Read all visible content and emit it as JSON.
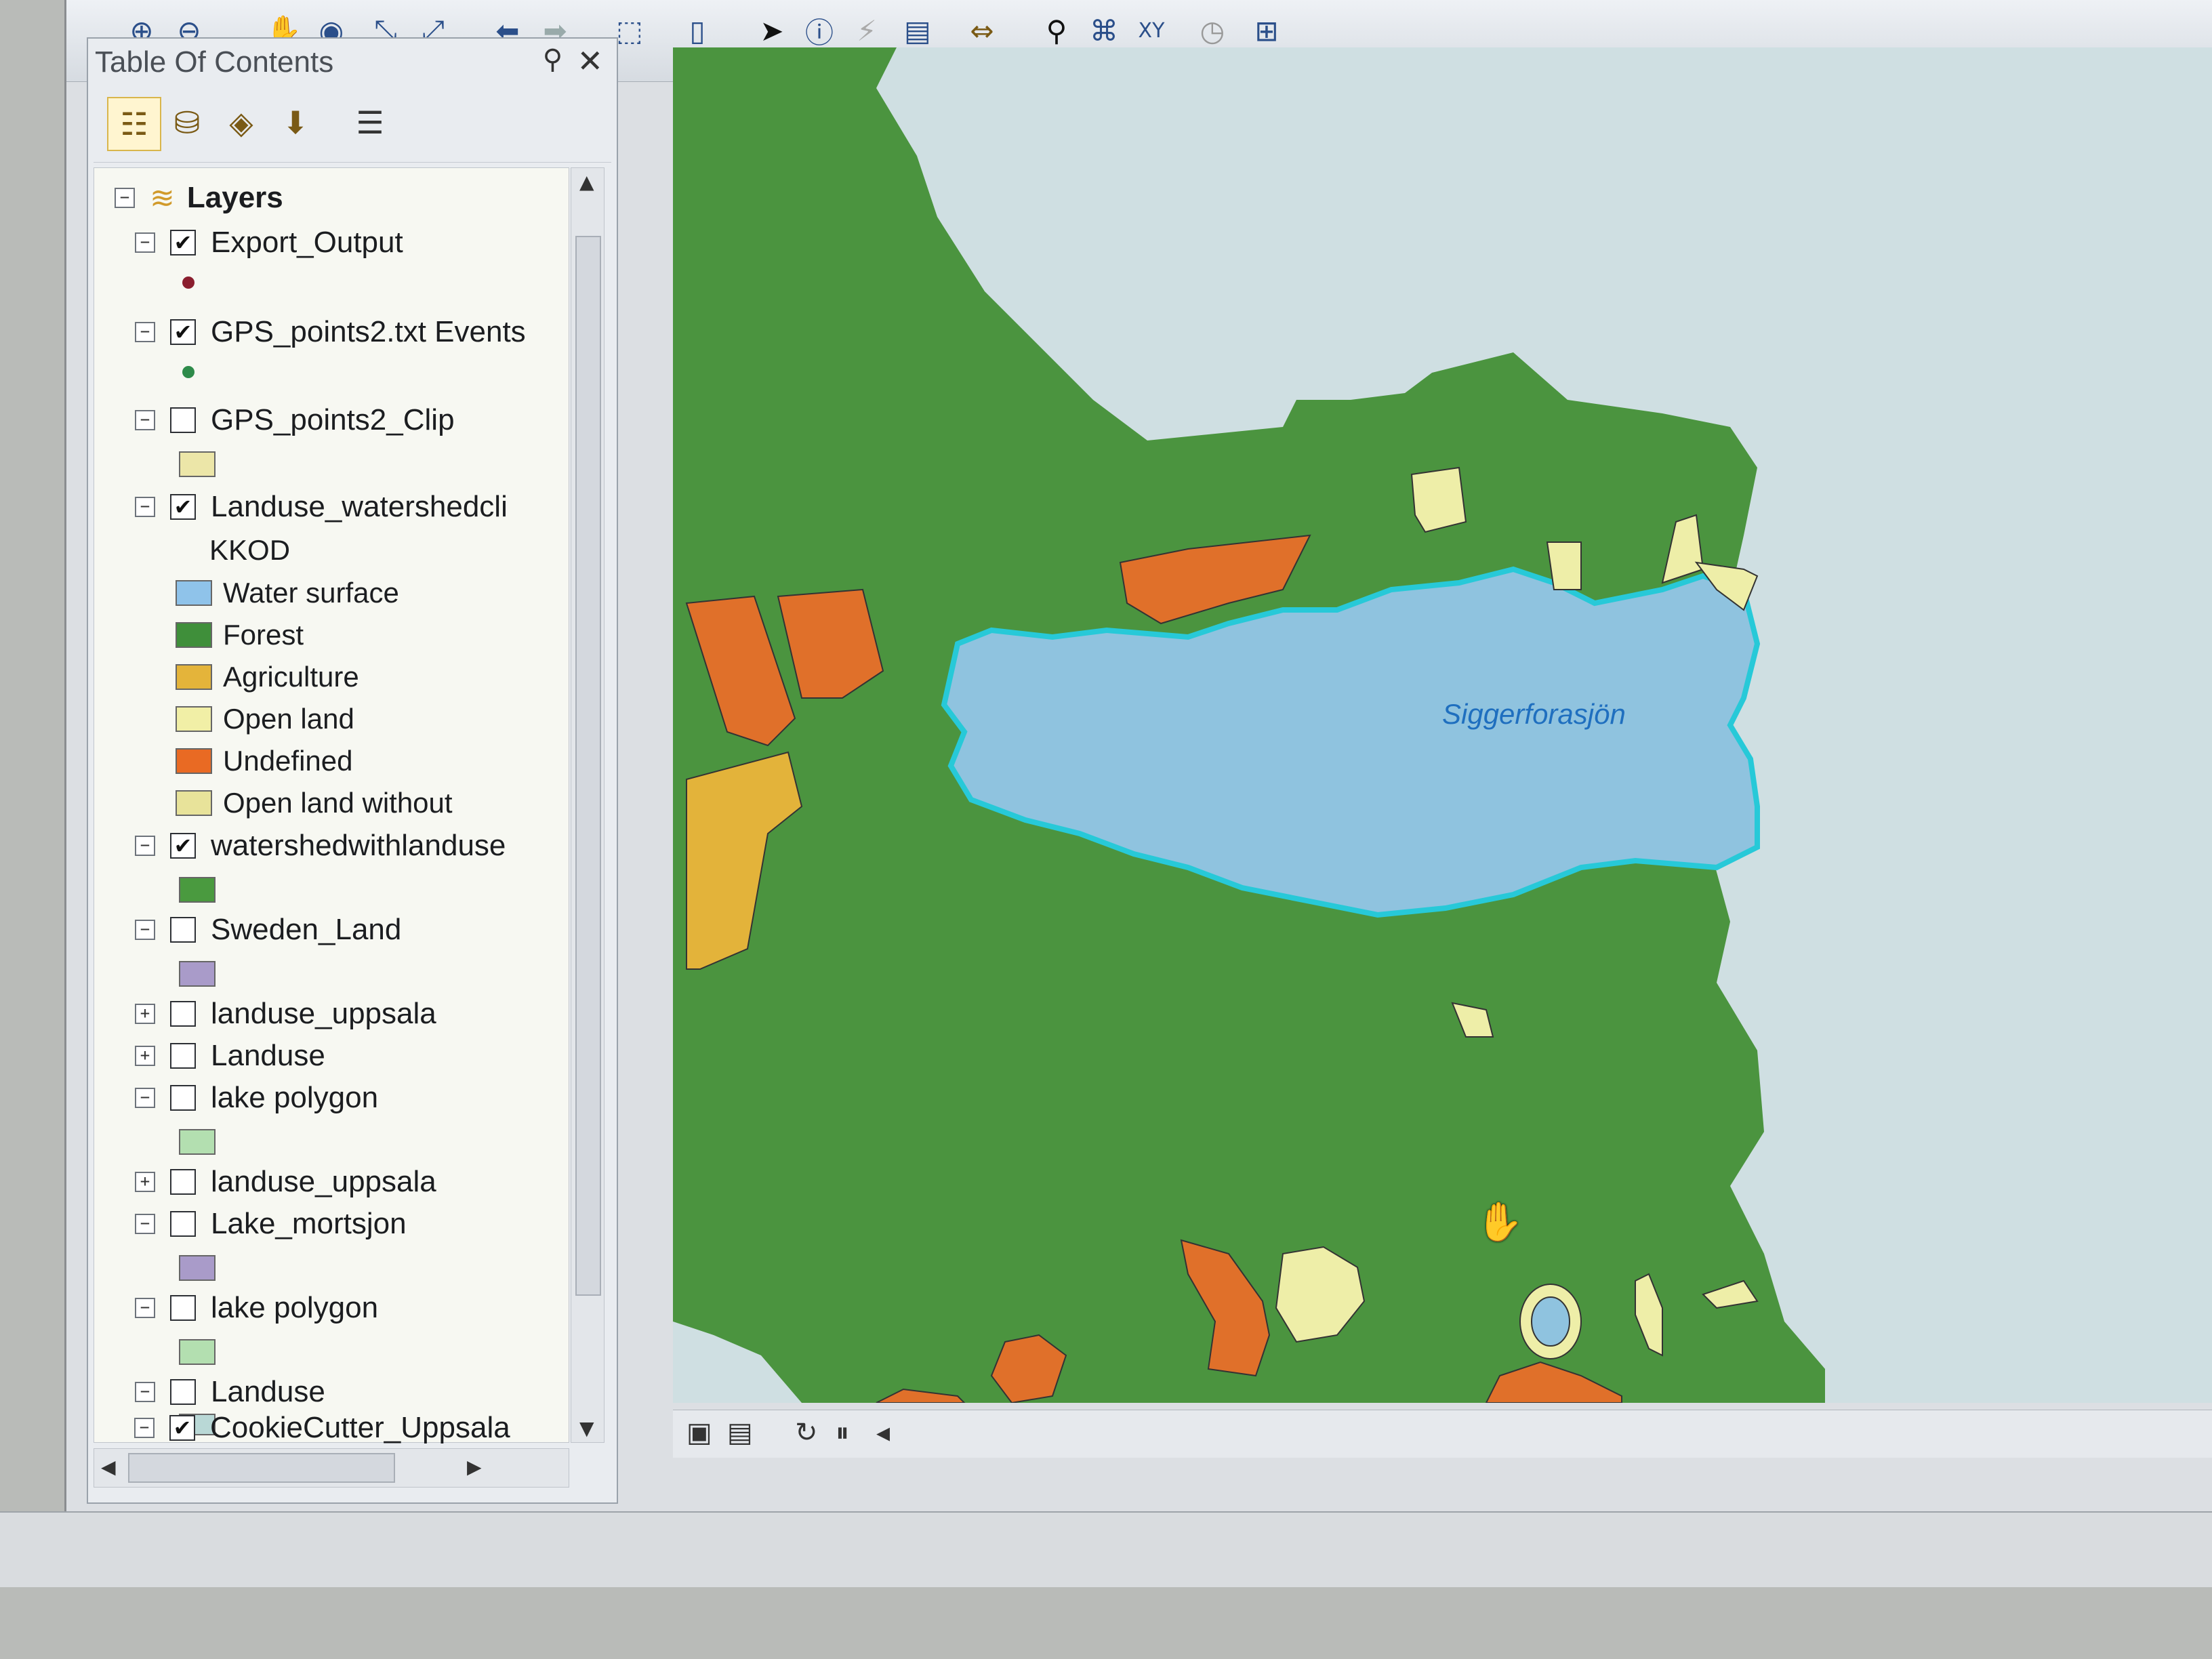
{
  "toc": {
    "title": "Table Of Contents",
    "root_label": "Layers",
    "layers": [
      {
        "name": "Export_Output",
        "checked": true,
        "expander": "−"
      },
      {
        "name": "GPS_points2.txt Events",
        "checked": true,
        "expander": "−"
      },
      {
        "name": "GPS_points2_Clip",
        "checked": false,
        "expander": "−"
      },
      {
        "name": "Landuse_watershedcli",
        "checked": true,
        "expander": "−"
      },
      {
        "name": "watershedwithlanduse",
        "checked": true,
        "expander": "−"
      },
      {
        "name": "Sweden_Land",
        "checked": false,
        "expander": "−"
      },
      {
        "name": "landuse_uppsala",
        "checked": false,
        "expander": "+"
      },
      {
        "name": "Landuse",
        "checked": false,
        "expander": "+"
      },
      {
        "name": "lake polygon",
        "checked": false,
        "expander": "−"
      },
      {
        "name": "landuse_uppsala",
        "checked": false,
        "expander": "+"
      },
      {
        "name": "Lake_mortsjon",
        "checked": false,
        "expander": "−"
      },
      {
        "name": "lake polygon",
        "checked": false,
        "expander": "−"
      },
      {
        "name": "Landuse",
        "checked": false,
        "expander": "−"
      },
      {
        "name": "CookieCutter_Uppsala",
        "checked": true,
        "expander": "−"
      }
    ],
    "field_name": "KKOD",
    "legend": [
      {
        "label": "Water surface",
        "color": "#8fc3ea"
      },
      {
        "label": "Forest",
        "color": "#3f8f3a"
      },
      {
        "label": "Agriculture",
        "color": "#e4b43a"
      },
      {
        "label": "Open land",
        "color": "#f1efa6"
      },
      {
        "label": "Undefined",
        "color": "#e96a23"
      },
      {
        "label": "Open land without",
        "color": "#e8e39a"
      }
    ],
    "swatch_colors": {
      "export_output": "#8a1e2e",
      "gps_events": "#2e8b4a",
      "gps_clip": "#ece6a8",
      "watershed": "#4a9a3f",
      "sweden_land": "#a99bc9",
      "lake_polygon_1": "#b3dfb0",
      "lake_mortsjon": "#a99bc9",
      "lake_polygon_2": "#b3dfb0",
      "landuse": "#b9d8d6"
    }
  },
  "map": {
    "lake_label": "Siggerforasjön",
    "colors": {
      "background": "#cfdfe2",
      "forest": "#4b943f",
      "lake": "#8fc3df",
      "lake_outline": "#27c9d8",
      "undefined": "#e0702a",
      "open_land": "#eeeea8",
      "agriculture": "#e3b33a"
    }
  },
  "icons": {
    "toolbar": [
      "zoom-in-icon",
      "zoom-out-icon",
      "pan-icon",
      "globe-icon",
      "back-icon",
      "forward-icon",
      "select-icon",
      "identify-icon",
      "html-popup-icon",
      "measure-icon",
      "find-icon",
      "goto-xy-icon"
    ],
    "toc_tools": [
      "list-by-drawing-order-icon",
      "list-by-source-icon",
      "list-by-visibility-icon",
      "list-by-selection-icon",
      "options-icon"
    ]
  }
}
